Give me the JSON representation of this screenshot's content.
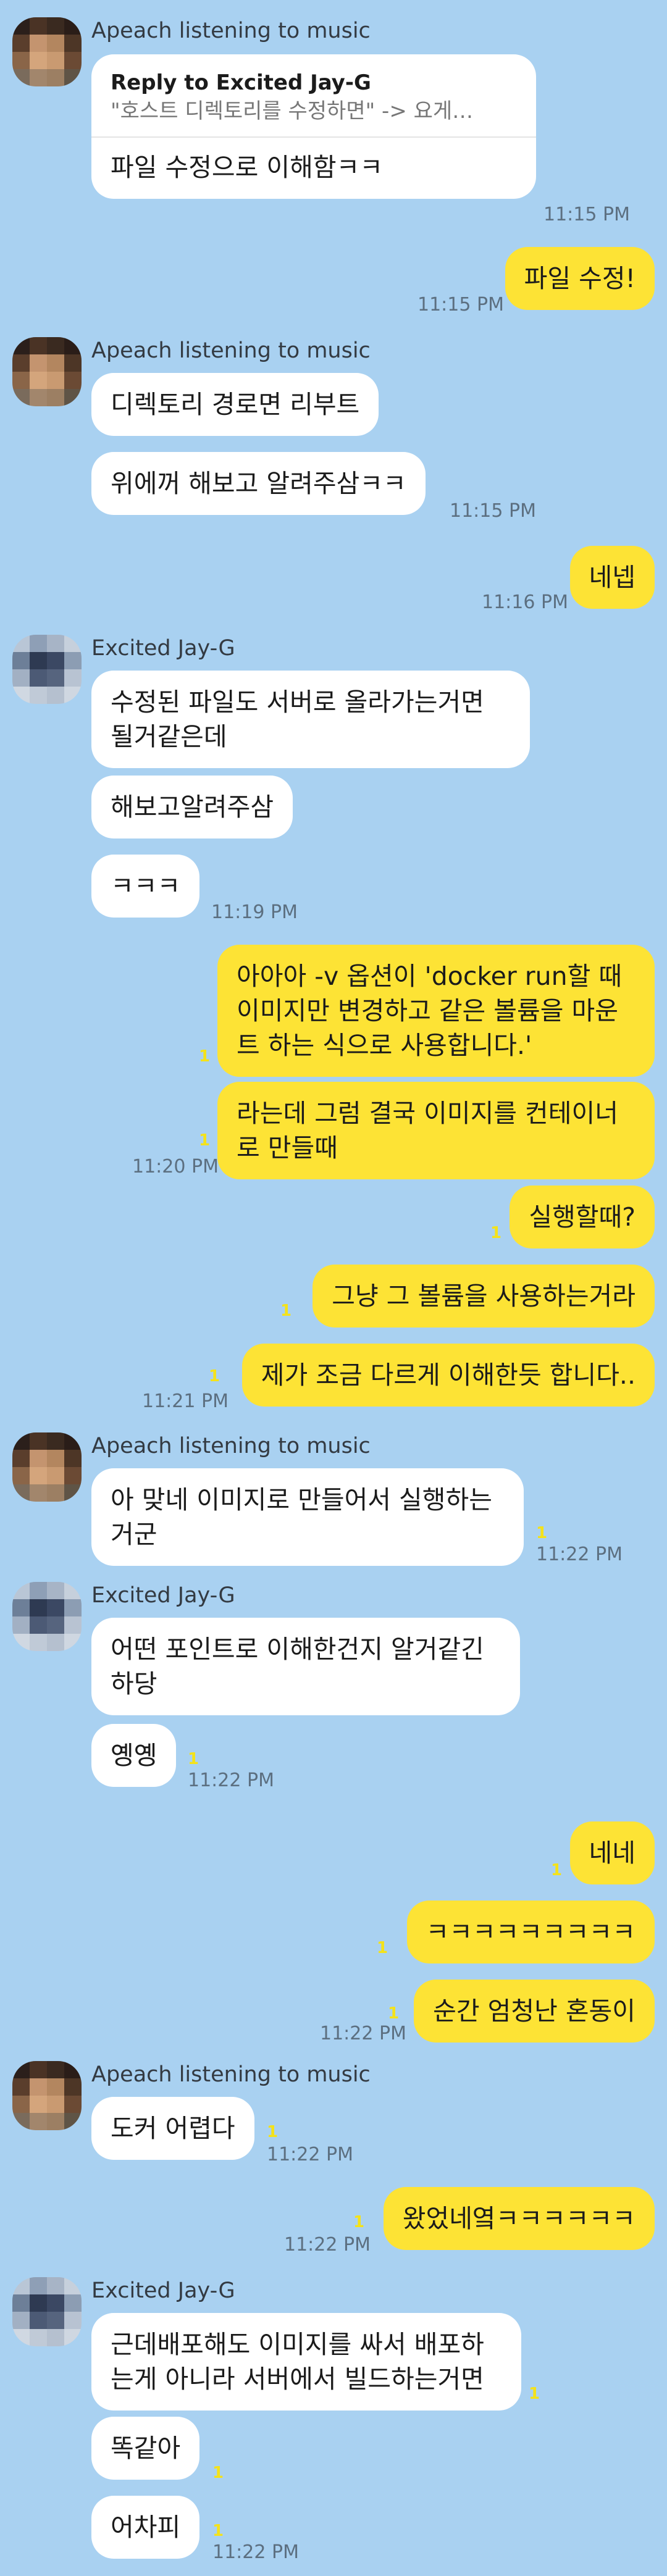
{
  "senders": {
    "apeach": "Apeach listening to music",
    "jayg": "Excited Jay-G"
  },
  "reply": {
    "title": "Reply to Excited Jay-G",
    "quote": "\"호스트 디렉토리를 수정하면\" -> 요게…",
    "text": "파일 수정으로 이해함ㅋㅋ"
  },
  "messages": {
    "m1": "파일 수정!",
    "m2": "디렉토리 경로면 리부트",
    "m3": "위에꺼 해보고 알려주삼ㅋㅋ",
    "m4": "네넵",
    "m5": "수정된 파일도 서버로 올라가는거면 될거같은데",
    "m6": "해보고알려주삼",
    "m7": "ㅋㅋㅋ",
    "m8": "아아아 -v 옵션이 'docker run할 때 이미지만 변경하고 같은 볼륨을 마운트 하는 식으로 사용합니다.'",
    "m9": "라는데 그럼 결국 이미지를 컨테이너로 만들때",
    "m10": "실행할때?",
    "m11": "그냥 그 볼륨을 사용하는거라",
    "m12": "제가 조금 다르게 이해한듯 합니다..",
    "m13": "아 맞네 이미지로 만들어서 실행하는 거군",
    "m14": "어떤 포인트로 이해한건지 알거같긴 하당",
    "m15": "옝옝",
    "m16": "네네",
    "m17": "ㅋㅋㅋㅋㅋㅋㅋㅋㅋ",
    "m18": "순간 엄청난 혼동이",
    "m19": "도커 어렵다",
    "m20": "왔었네옄ㅋㅋㅋㅋㅋㅋ",
    "m21": "근데배포해도 이미지를 싸서 배포하는게 아니라 서버에서 빌드하는거면",
    "m22": "똑같아",
    "m23": "어차피"
  },
  "times": {
    "t1115": "11:15 PM",
    "t1116": "11:16 PM",
    "t1119": "11:19 PM",
    "t1120": "11:20 PM",
    "t1121": "11:21 PM",
    "t1122": "11:22 PM"
  },
  "unread_marker": "1",
  "colors": {
    "background": "#a9d1f1",
    "incoming_bubble": "#ffffff",
    "outgoing_bubble": "#fde335"
  }
}
